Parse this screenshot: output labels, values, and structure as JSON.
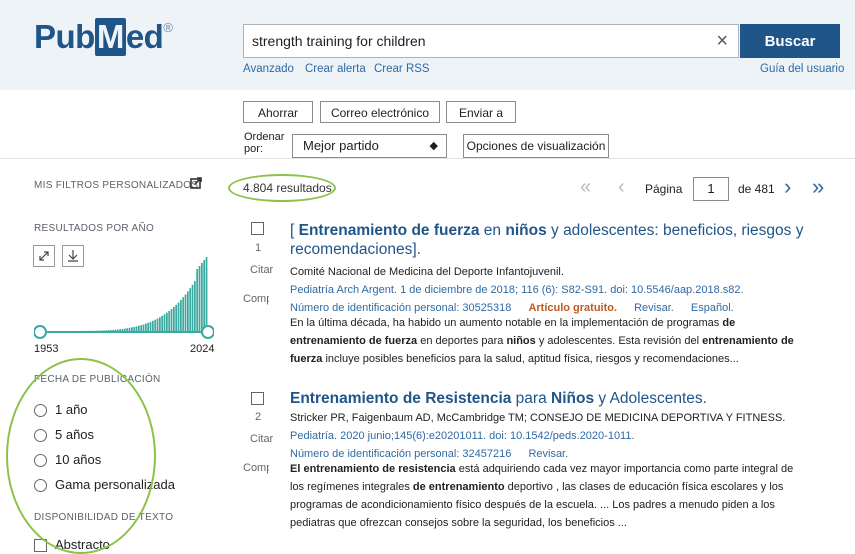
{
  "header": {
    "logo_pub": "Pub",
    "logo_m": "M",
    "logo_ed": "ed",
    "logo_reg": "®",
    "search_value": "strength training for children",
    "search_button": "Buscar",
    "clear_label": "×",
    "links": [
      "Avanzado",
      "Crear alerta",
      "Crear RSS"
    ],
    "user_guide": "Guía del usuario"
  },
  "toolbar": {
    "save": "Ahorrar",
    "email": "Correo electrónico",
    "send": "Enviar a",
    "sort_label_1": "Ordenar",
    "sort_label_2": "por:",
    "sort_value": "Mejor partido",
    "display_options": "Opciones de visualización"
  },
  "sidebar": {
    "my_filters": "MIS FILTROS PERSONALIZADOS",
    "results_by_year": "RESULTADOS POR AÑO",
    "year_start": "1953",
    "year_end": "2024",
    "pub_date_heading": "FECHA DE PUBLICACIÓN",
    "date_options": [
      "1 año",
      "5 años",
      "10 años",
      "Gama personalizada"
    ],
    "text_availability": "DISPONIBILIDAD DE TEXTO",
    "abstract": "Abstracto"
  },
  "results_bar": {
    "count": "4.804 resultados",
    "page_label": "Página",
    "page_value": "1",
    "page_of": "de 481"
  },
  "results": [
    {
      "number": "1",
      "cite": "Citar",
      "share": "Compartir",
      "title_parts": [
        "[ ",
        "Entrenamiento de fuerza",
        " en ",
        "niños",
        " y adolescentes: beneficios, riesgos y"
      ],
      "title_line2": "recomendaciones].",
      "authors": "Comité Nacional de Medicina del Deporte Infantojuvenil.",
      "journal": "Pediatría Arch Argent. 1 de diciembre de 2018; 116 (6): S82-S91. doi: 10.5546/aap.2018.s82.",
      "pmid": "Número de identificación personal: 30525318",
      "free_article": "Artículo gratuito.",
      "review": "Revisar.",
      "language": "Español.",
      "snippet_1a": "En la última década, ha habido un aumento notable en la implementación de programas ",
      "snippet_1b": "de",
      "snippet_2a": "entrenamiento de fuerza",
      "snippet_2b": " en deportes para ",
      "snippet_2c": "niños",
      "snippet_2d": " y adolescentes. Esta revisión del ",
      "snippet_2e": "entrenamiento de",
      "snippet_3a": "fuerza",
      "snippet_3b": " incluye posibles beneficios para la salud, aptitud física, riesgos y recomendaciones..."
    },
    {
      "number": "2",
      "cite": "Citar",
      "share": "Compartir",
      "title_parts": [
        "Entrenamiento de Resistencia",
        " para ",
        "Niños",
        " y Adolescentes."
      ],
      "authors": "Stricker PR, Faigenbaum AD, McCambridge TM; CONSEJO DE MEDICINA DEPORTIVA Y FITNESS.",
      "journal": "Pediatría. 2020 junio;145(6):e20201011. doi: 10.1542/peds.2020-1011.",
      "pmid": "Número de identificación personal: 32457216",
      "review": "Revisar.",
      "snippet_1a": "El entrenamiento de resistencia",
      "snippet_1b": " está adquiriendo cada vez mayor importancia como parte integral de",
      "snippet_2a": "los regímenes integrales ",
      "snippet_2b": "de entrenamiento",
      "snippet_2c": " deportivo , las clases de educación física escolares y los",
      "snippet_3": "programas de acondicionamiento físico después de la escuela. ... Los padres a menudo piden a los",
      "snippet_4": "pediatras que ofrezcan consejos sobre la seguridad, los beneficios ..."
    }
  ],
  "colors": {
    "brand": "#20558a",
    "link": "#2f6aa5",
    "free_article": "#c05a1f",
    "histogram": "#3aa99f",
    "annotation": "#8bc34a"
  },
  "histogram": {
    "bar_count": 72,
    "slider_start_fraction": 0,
    "slider_end_fraction": 1
  }
}
